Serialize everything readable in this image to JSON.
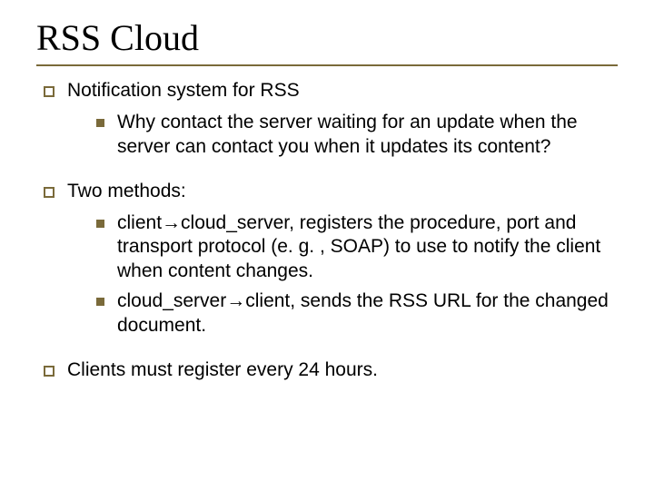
{
  "title": "RSS Cloud",
  "items": {
    "p1": {
      "text": "Notification system for RSS"
    },
    "p1_n1": {
      "text": "Why contact the server waiting for an update when the server can contact you when it updates its content?"
    },
    "p2": {
      "text": "Two methods:"
    },
    "p2_n1": {
      "pre": "client",
      "arrow": "→",
      "post": "cloud_server, registers the procedure, port and transport protocol (e. g. , SOAP) to use to notify the client when content changes."
    },
    "p2_n2": {
      "pre": "cloud_server",
      "arrow": "→",
      "post": "client, sends the RSS URL for the changed document."
    },
    "p3": {
      "text": "Clients must register every 24 hours."
    }
  }
}
